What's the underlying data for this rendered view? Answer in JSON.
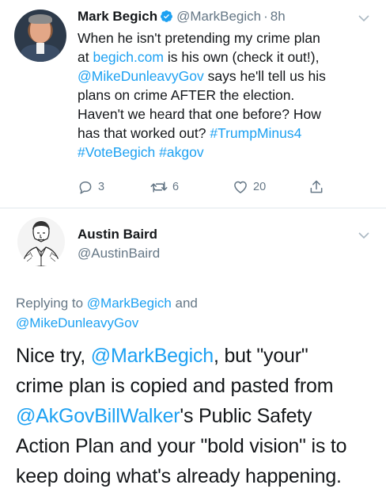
{
  "tweet1": {
    "author_name": "Mark Begich",
    "handle": "@MarkBegich",
    "separator": "·",
    "time": "8h",
    "body_lines": [
      [
        {
          "text": "When he isn't pretending my crime plan"
        }
      ],
      [
        {
          "text": "at "
        },
        {
          "text": "begich.com",
          "link": true
        },
        {
          "text": " is his own (check it out!),"
        }
      ],
      [
        {
          "text": "@MikeDunleavyGov",
          "link": true
        },
        {
          "text": " says he'll tell us his"
        }
      ],
      [
        {
          "text": "plans on crime AFTER the election."
        }
      ],
      [
        {
          "text": "Haven't we heard that one before? How"
        }
      ],
      [
        {
          "text": "has that worked out? "
        },
        {
          "text": "#TrumpMinus4",
          "link": true
        }
      ],
      [
        {
          "text": "#VoteBegich",
          "link": true
        },
        {
          "text": " "
        },
        {
          "text": "#akgov",
          "link": true
        }
      ]
    ],
    "reply_count": "3",
    "retweet_count": "6",
    "like_count": "20",
    "icons": {
      "reply": "reply-icon",
      "retweet": "retweet-icon",
      "like": "heart-icon",
      "share": "share-icon",
      "verified": "verified-badge-icon",
      "menu": "chevron-down-icon"
    }
  },
  "tweet2": {
    "author_name": "Austin Baird",
    "handle": "@AustinBaird",
    "replying_prefix": "Replying to ",
    "replying_to": [
      {
        "text": "@MarkBegich",
        "link": true
      },
      {
        "text": " and",
        "link": false
      },
      {
        "text": "@MikeDunleavyGov",
        "link": true
      }
    ],
    "body_lines": [
      [
        {
          "text": "Nice try, "
        },
        {
          "text": "@MarkBegich",
          "link": true
        },
        {
          "text": ", but \"your\""
        }
      ],
      [
        {
          "text": "crime plan is copied and pasted from"
        }
      ],
      [
        {
          "text": "@AkGovBillWalker",
          "link": true
        },
        {
          "text": "'s Public Safety"
        }
      ],
      [
        {
          "text": "Action Plan and your \"bold vision\" is to"
        }
      ],
      [
        {
          "text": "keep doing what's already happening."
        }
      ]
    ]
  },
  "colors": {
    "link": "#1da1f2",
    "text": "#14171a",
    "secondary": "#657786",
    "divider": "#e1e8ed"
  }
}
